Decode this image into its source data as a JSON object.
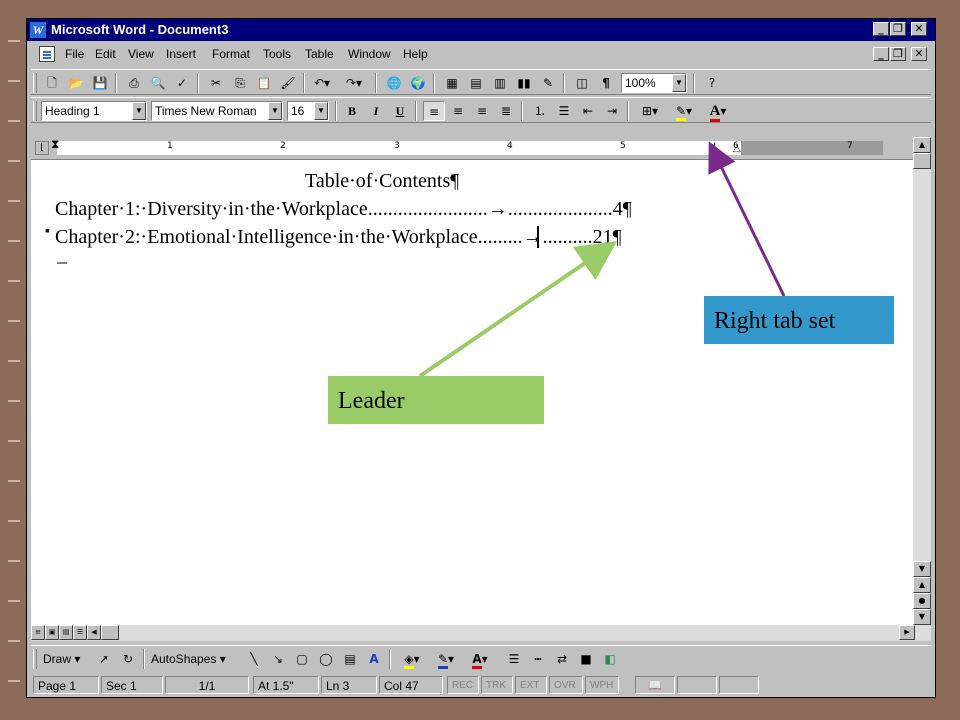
{
  "window": {
    "title": "Microsoft Word - Document3",
    "app_icon": "W"
  },
  "menu": [
    "File",
    "Edit",
    "View",
    "Insert",
    "Format",
    "Tools",
    "Table",
    "Window",
    "Help"
  ],
  "standard_toolbar": {
    "zoom": "100%",
    "show_hide_symbol": "¶"
  },
  "formatting_toolbar": {
    "style": "Heading 1",
    "font": "Times New Roman",
    "size": "16",
    "bold": "B",
    "italic": "I",
    "underline": "U",
    "font_color_glyph": "A"
  },
  "ruler": {
    "numbers": [
      "1",
      "2",
      "3",
      "4",
      "5",
      "6",
      "7"
    ]
  },
  "document": {
    "heading": "Table·of·Contents¶",
    "lines": [
      {
        "text": "Chapter·1:·Diversity·in·the·Workplace........................→.....................4¶"
      },
      {
        "text": "Chapter·2:·Emotional·Intelligence·in·the·Workplace.........→..........21¶"
      }
    ]
  },
  "drawing_toolbar": {
    "draw": "Draw",
    "autoshapes": "AutoShapes"
  },
  "status": {
    "page": "Page 1",
    "section": "Sec 1",
    "page_of": "1/1",
    "at": "At 1.5\"",
    "line": "Ln 3",
    "col": "Col 47",
    "rec": "REC",
    "trk": "TRK",
    "ext": "EXT",
    "ovr": "OVR",
    "wph": "WPH"
  },
  "annotations": {
    "right_tab": "Right tab set",
    "leader": "Leader"
  },
  "colors": {
    "titlebar": "#00007b",
    "right_tab_callout": "#3399cc",
    "leader_callout": "#99cc66",
    "right_tab_arrow": "#7a2a8a",
    "leader_arrow": "#99cc66"
  }
}
